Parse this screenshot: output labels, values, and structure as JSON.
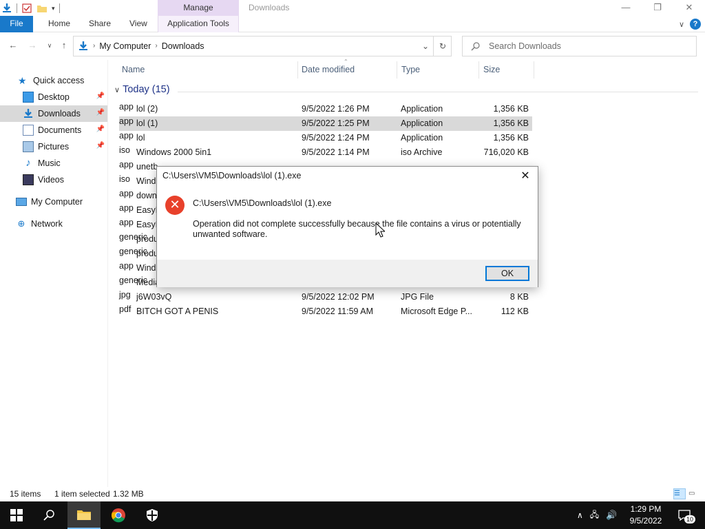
{
  "titlebar": {
    "context_tab": "Manage",
    "window_title": "Downloads",
    "minimize_icon": "minimize-icon",
    "maximize_icon": "restore-icon",
    "close_icon": "close-icon"
  },
  "ribbon": {
    "tabs": [
      "File",
      "Home",
      "Share",
      "View",
      "Application Tools"
    ]
  },
  "address": {
    "breadcrumbs": [
      "My Computer",
      "Downloads"
    ],
    "search_placeholder": "Search Downloads"
  },
  "sidebar": {
    "quick_access": "Quick access",
    "items": [
      {
        "label": "Desktop",
        "icon": "desktop-icon",
        "pinned": true
      },
      {
        "label": "Downloads",
        "icon": "downloads-icon",
        "pinned": true,
        "selected": true
      },
      {
        "label": "Documents",
        "icon": "documents-icon",
        "pinned": true
      },
      {
        "label": "Pictures",
        "icon": "pictures-icon",
        "pinned": true
      },
      {
        "label": "Music",
        "icon": "music-icon"
      },
      {
        "label": "Videos",
        "icon": "videos-icon"
      }
    ],
    "my_computer": "My Computer",
    "network": "Network"
  },
  "columns": {
    "name": "Name",
    "date": "Date modified",
    "type": "Type",
    "size": "Size"
  },
  "group": {
    "label": "Today (15)"
  },
  "files": [
    {
      "name": "lol (2)",
      "date": "9/5/2022 1:26 PM",
      "type": "Application",
      "size": "1,356 KB"
    },
    {
      "name": "lol (1)",
      "date": "9/5/2022 1:25 PM",
      "type": "Application",
      "size": "1,356 KB"
    },
    {
      "name": "lol",
      "date": "9/5/2022 1:24 PM",
      "type": "Application",
      "size": "1,356 KB"
    },
    {
      "name": "Windows 2000 5in1",
      "date": "9/5/2022 1:14 PM",
      "type": "iso Archive",
      "size": "716,020 KB"
    },
    {
      "name": "unetb",
      "date": "",
      "type": "",
      "size": ""
    },
    {
      "name": "Wind",
      "date": "",
      "type": "",
      "size": ""
    },
    {
      "name": "down",
      "date": "",
      "type": "",
      "size": ""
    },
    {
      "name": "EasyB",
      "date": "",
      "type": "",
      "size": ""
    },
    {
      "name": "EasyB",
      "date": "",
      "type": "",
      "size": ""
    },
    {
      "name": "produ",
      "date": "",
      "type": "",
      "size": ""
    },
    {
      "name": "produ",
      "date": "",
      "type": "",
      "size": ""
    },
    {
      "name": "Windo",
      "date": "",
      "type": "",
      "size": ""
    },
    {
      "name": "Media",
      "date": "",
      "type": "",
      "size": ""
    },
    {
      "name": "j6W03vQ",
      "date": "9/5/2022 12:02 PM",
      "type": "JPG File",
      "size": "8 KB"
    },
    {
      "name": "BITCH GOT A PENIS",
      "date": "9/5/2022 11:59 AM",
      "type": "Microsoft Edge P...",
      "size": "112 KB"
    }
  ],
  "dialog": {
    "title": "C:\\Users\\VM5\\Downloads\\lol (1).exe",
    "path": "C:\\Users\\VM5\\Downloads\\lol (1).exe",
    "message": "Operation did not complete successfully because the file contains a virus or potentially unwanted software.",
    "ok": "OK"
  },
  "status": {
    "items": "15 items",
    "selected": "1 item selected",
    "size": "1.32 MB"
  },
  "taskbar": {
    "time": "1:29 PM",
    "date": "9/5/2022",
    "notification_count": "10"
  }
}
